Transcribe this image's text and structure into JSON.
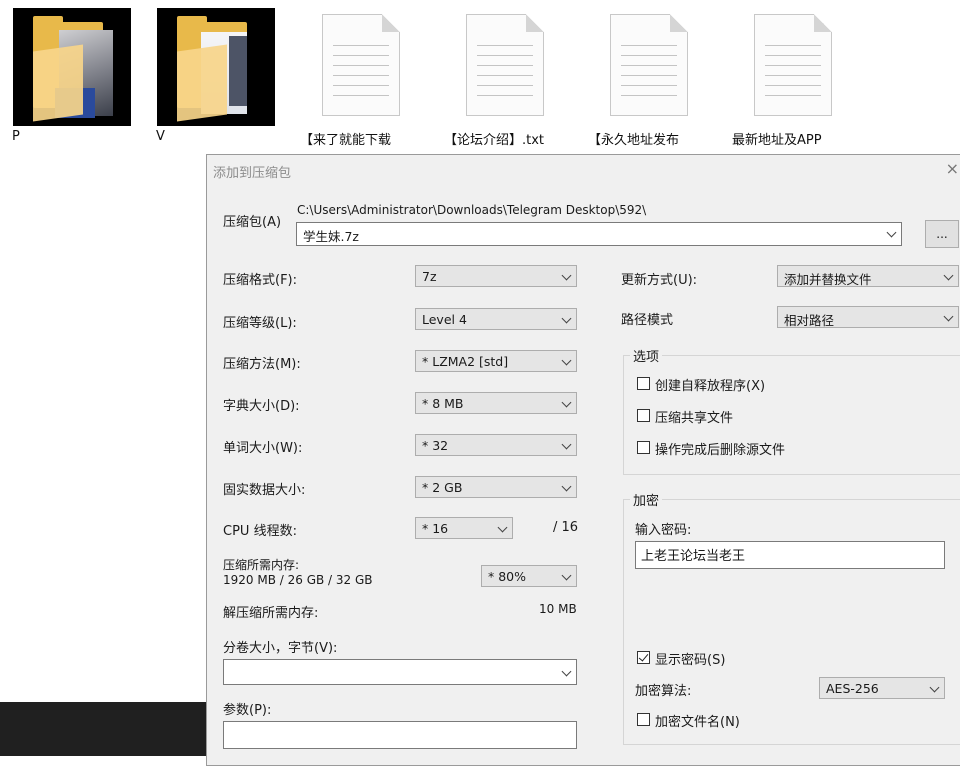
{
  "desktop": {
    "folders": [
      {
        "label": "P"
      },
      {
        "label": "V"
      }
    ],
    "files": [
      {
        "label": "【来了就能下载"
      },
      {
        "label": "【论坛介绍】.txt"
      },
      {
        "label": "【永久地址发布"
      },
      {
        "label": "最新地址及APP"
      }
    ]
  },
  "dialog": {
    "title": "添加到压缩包",
    "close": "×",
    "archive_label": "压缩包(A)",
    "archive_path": "C:\\Users\\Administrator\\Downloads\\Telegram Desktop\\592\\",
    "archive_name": "学生妹.7z",
    "browse_label": "...",
    "format_label": "压缩格式(F):",
    "format_value": "7z",
    "level_label": "压缩等级(L):",
    "level_value": "Level 4",
    "method_label": "压缩方法(M):",
    "method_value": "*  LZMA2 [std]",
    "dict_label": "字典大小(D):",
    "dict_value": "*  8 MB",
    "word_label": "单词大小(W):",
    "word_value": "*  32",
    "solid_label": "固实数据大小:",
    "solid_value": "*  2 GB",
    "cpu_label": "CPU 线程数:",
    "cpu_value": "*  16",
    "cpu_max": "/ 16",
    "mem_comp_label": "压缩所需内存:",
    "mem_comp_value": "1920 MB / 26 GB / 32 GB",
    "mem_pct_value": "* 80%",
    "mem_decomp_label": "解压缩所需内存:",
    "mem_decomp_value": "10 MB",
    "volume_label": "分卷大小，字节(V):",
    "volume_value": "",
    "params_label": "参数(P):",
    "params_value": "",
    "update_label": "更新方式(U):",
    "update_value": "添加并替换文件",
    "path_label": "路径模式",
    "path_value": "相对路径",
    "options": {
      "title": "选项",
      "sfx": {
        "label": "创建自释放程序(X)",
        "checked": false
      },
      "shared": {
        "label": "压缩共享文件",
        "checked": false
      },
      "delete": {
        "label": "操作完成后删除源文件",
        "checked": false
      }
    },
    "encryption": {
      "title": "加密",
      "password_label": "输入密码:",
      "password_value": "上老王论坛当老王",
      "show_password": {
        "label": "显示密码(S)",
        "checked": true
      },
      "method_label": "加密算法:",
      "method_value": "AES-256",
      "encrypt_names": {
        "label": "加密文件名(N)",
        "checked": false
      }
    }
  }
}
